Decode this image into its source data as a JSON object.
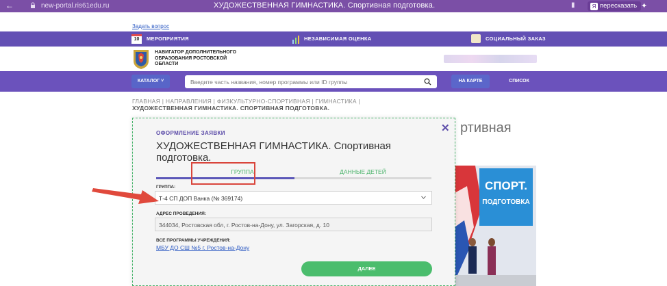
{
  "browser": {
    "url": "new-portal.ris61edu.ru",
    "title": "ХУДОЖЕСТВЕННАЯ ГИМНАСТИКА. Спортивная подготовка.",
    "retell": "пересказать"
  },
  "ask_question": "Задать вопрос",
  "topnav": {
    "calendar_day": "10",
    "events": "МЕРОПРИЯТИЯ",
    "independent": "НЕЗАВИСИМАЯ ОЦЕНКА",
    "social": "СОЦИАЛЬНЫЙ ЗАКАЗ"
  },
  "header": {
    "navigator": "НАВИГАТОР ДОПОЛНИТЕЛЬНОГО ОБРАЗОВАНИЯ РОСТОВСКОЙ ОБЛАСТИ"
  },
  "search": {
    "catalog": "КАТАЛОГ",
    "placeholder": "Введите часть названия, номер программы или ID группы",
    "map": "НА КАРТЕ",
    "list": "СПИСОК"
  },
  "breadcrumb": {
    "path": "ГЛАВНАЯ  |  НАПРАВЛЕНИЯ  |  ФИЗКУЛЬТУРНО-СПОРТИВНАЯ  |  ГИМНАСТИКА  |",
    "current": "ХУДОЖЕСТВЕННАЯ ГИМНАСТИКА. СПОРТИВНАЯ ПОДГОТОВКА."
  },
  "background": {
    "title": "ртивная",
    "poster_line1": "СПОРТ.",
    "poster_line2": "ПОДГОТОВКА"
  },
  "modal": {
    "header": "ОФОРМЛЕНИЕ ЗАЯВКИ",
    "title": "ХУДОЖЕСТВЕННАЯ ГИМНАСТИКА. Спортивная подготовка.",
    "tabs": [
      "ГРУППА",
      "ДАННЫЕ ДЕТЕЙ"
    ],
    "group_label": "ГРУППА:",
    "group_value": "Т-4 СП ДОП Ванка (№ 369174)",
    "address_label": "АДРЕС ПРОВЕДЕНИЯ:",
    "address_value": "344034, Ростовская обл, г. Ростов-на-Дону, ул. Загорская, д. 10",
    "programs_label": "ВСЕ ПРОГРАММЫ УЧРЕЖДЕНИЯ:",
    "programs_link": "МБУ ДО СШ №5 г. Ростов-на-Дону",
    "next": "ДАЛЕЕ"
  },
  "colors": {
    "accent": "#6350b4",
    "green": "#4bbd6d",
    "highlight": "#d9453b"
  }
}
